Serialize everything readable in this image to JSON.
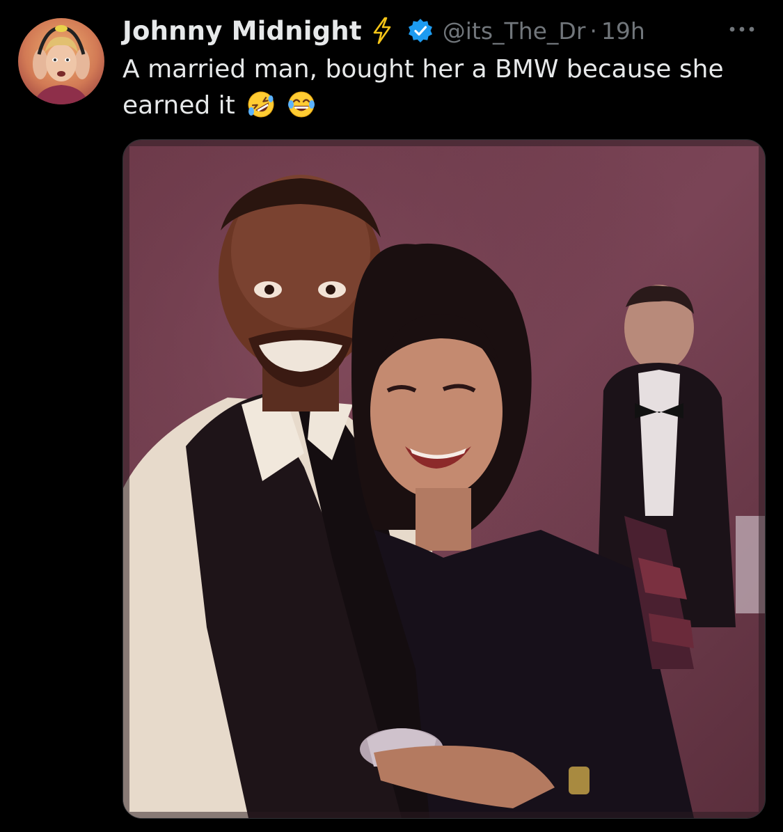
{
  "tweet": {
    "display_name": "Johnny Midnight",
    "handle": "@its_The_Dr",
    "separator": "·",
    "timestamp": "19h",
    "text_line1": "A married man, bought her a BMW because she",
    "text_line2": "earned it",
    "emojis": [
      "rolling-on-floor-laughing-emoji",
      "face-with-tears-of-joy-emoji"
    ]
  },
  "icons": {
    "bolt": "lightning-bolt-icon",
    "verified": "verified-badge-icon",
    "more": "more-options-icon"
  },
  "colors": {
    "background": "#000000",
    "text_primary": "#e7e9ea",
    "text_secondary": "#71767b",
    "verified_blue": "#1d9bf0"
  }
}
